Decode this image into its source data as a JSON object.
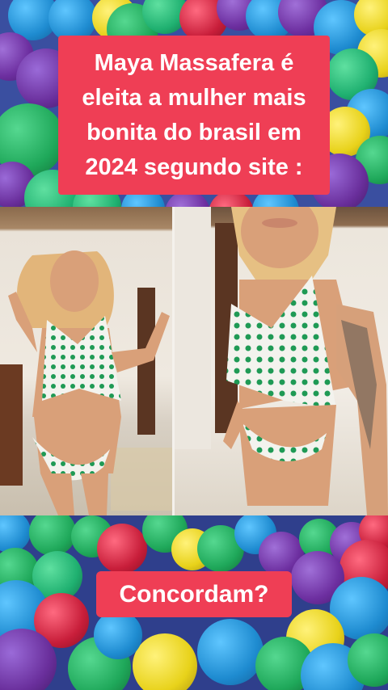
{
  "headline": {
    "text": "Maya Massafera é eleita a mulher mais bonita do brasil em 2024 segundo site :",
    "background": "#ef3e55",
    "color": "#ffffff"
  },
  "question": {
    "text": "Concordam?",
    "background": "#ef3e55",
    "color": "#ffffff"
  },
  "scene": {
    "background": "ball pit with colored plastic balls",
    "ball_colors": [
      "#1e9ad6",
      "#1faa5c",
      "#7b3fa8",
      "#e8d21a",
      "#c81e3a",
      "#3b5fc8"
    ],
    "photos": [
      "left-photo",
      "right-photo"
    ]
  }
}
